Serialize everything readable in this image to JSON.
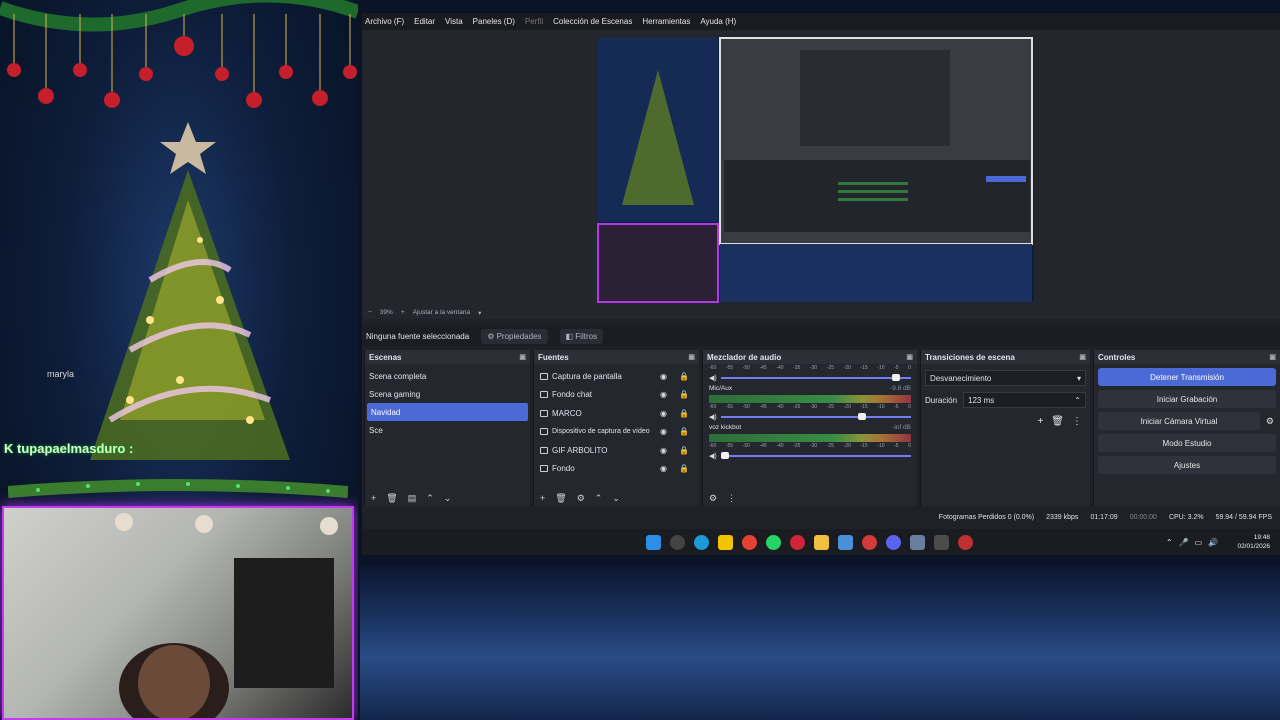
{
  "stream_overlay": {
    "chat_username": "K tupapaelmasduro :",
    "tag": "maryla"
  },
  "obs": {
    "menu": [
      "Archivo (F)",
      "Editar",
      "Vista",
      "Paneles (D)",
      "Perfil",
      "Colección de Escenas",
      "Herramientas",
      "Ayuda (H)"
    ],
    "zoom": "39%",
    "fit_label": "Ajustar a la ventana",
    "no_source": "Ninguna fuente seleccionada",
    "properties": "Propiedades",
    "filters": "Filtros",
    "scenes": {
      "title": "Escenas",
      "items": [
        "Scena completa",
        "Scena gaming",
        "Navidad",
        "Sce"
      ],
      "selected": "Navidad"
    },
    "sources": {
      "title": "Fuentes",
      "items": [
        "Captura de pantalla",
        "Fondo chat",
        "MARCO",
        "Dispositivo de captura de vídeo",
        "GIF ARBOLITO",
        "Fondo"
      ]
    },
    "mixer": {
      "title": "Mezclador de audio",
      "channels": [
        {
          "name": "",
          "db": "",
          "level": 0.92
        },
        {
          "name": "Mic/Aux",
          "db": "-9.8 dB",
          "level": 0.74
        },
        {
          "name": "voz kickbot",
          "db": "-inf dB",
          "level": 0.02
        }
      ],
      "scale": [
        "-60",
        "-55",
        "-50",
        "-45",
        "-40",
        "-35",
        "-30",
        "-25",
        "-20",
        "-15",
        "-10",
        "-5",
        "0"
      ]
    },
    "transitions": {
      "title": "Transiciones de escena",
      "selected": "Desvanecimiento",
      "duration_label": "Duración",
      "duration_value": "123 ms"
    },
    "controls": {
      "title": "Controles",
      "buttons": [
        "Detener Transmisión",
        "Iniciar Grabación",
        "Iniciar Cámara Virtual",
        "Modo Estudio",
        "Ajustes"
      ]
    },
    "status": {
      "dropped": "Fotogramas Perdidos 0 (0.0%)",
      "bitrate": "2339 kbps",
      "stream_time": "01:17:09",
      "rec_time": "00:00:00",
      "cpu": "CPU: 3.2%",
      "fps": "59.94 / 59.94 FPS"
    },
    "taskbar": {
      "time": "19:48",
      "date": "02/01/2026"
    }
  },
  "colors": {
    "accent": "#4b6ad6",
    "webcam_border": "#c13cf0"
  }
}
